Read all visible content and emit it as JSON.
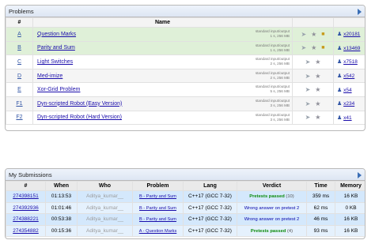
{
  "problems": {
    "header": "Problems",
    "columns": {
      "index": "#",
      "name": "Name"
    },
    "rows": [
      {
        "index": "A",
        "name": "Question Marks",
        "limits_line1": "standard input/output",
        "limits_line2": "1 s, 256 MB",
        "solved": true,
        "solvers": "x20181"
      },
      {
        "index": "B",
        "name": "Parity and Sum",
        "limits_line1": "standard input/output",
        "limits_line2": "1 s, 256 MB",
        "solved": true,
        "solvers": "x13469"
      },
      {
        "index": "C",
        "name": "Light Switches",
        "limits_line1": "standard input/output",
        "limits_line2": "2 s, 256 MB",
        "solved": false,
        "solvers": "x7518"
      },
      {
        "index": "D",
        "name": "Med-imize",
        "limits_line1": "standard input/output",
        "limits_line2": "2 s, 256 MB",
        "solved": false,
        "solvers": "x542"
      },
      {
        "index": "E",
        "name": "Xor-Grid Problem",
        "limits_line1": "standard input/output",
        "limits_line2": "5 s, 256 MB",
        "solved": false,
        "solvers": "x54"
      },
      {
        "index": "F1",
        "name": "Dyn-scripted Robot (Easy Version)",
        "limits_line1": "standard input/output",
        "limits_line2": "3 s, 256 MB",
        "solved": false,
        "solvers": "x234"
      },
      {
        "index": "F2",
        "name": "Dyn-scripted Robot (Hard Version)",
        "limits_line1": "standard input/output",
        "limits_line2": "3 s, 256 MB",
        "solved": false,
        "solvers": "x41"
      }
    ]
  },
  "submissions": {
    "header": "My Submissions",
    "columns": {
      "id": "#",
      "when": "When",
      "who": "Who",
      "problem": "Problem",
      "lang": "Lang",
      "verdict": "Verdict",
      "time": "Time",
      "memory": "Memory"
    },
    "rows": [
      {
        "id": "274398151",
        "when": "01:13:53",
        "who": "Aditya_kumar__",
        "problem": "B - Parity and Sum",
        "lang": "C++17 (GCC 7-32)",
        "verdict": "Pretests passed",
        "verdict_count": "(10)",
        "accepted": true,
        "time": "359 ms",
        "memory": "16 KB"
      },
      {
        "id": "274392936",
        "when": "01:01:46",
        "who": "Aditya_kumar__",
        "problem": "B - Parity and Sum",
        "lang": "C++17 (GCC 7-32)",
        "verdict": "Wrong answer on pretest 2",
        "verdict_count": "",
        "accepted": false,
        "time": "62 ms",
        "memory": "0 KB"
      },
      {
        "id": "274388221",
        "when": "00:53:38",
        "who": "Aditya_kumar__",
        "problem": "B - Parity and Sum",
        "lang": "C++17 (GCC 7-32)",
        "verdict": "Wrong answer on pretest 2",
        "verdict_count": "",
        "accepted": false,
        "time": "46 ms",
        "memory": "16 KB"
      },
      {
        "id": "274354882",
        "when": "00:15:36",
        "who": "Aditya_kumar__",
        "problem": "A - Question Marks",
        "lang": "C++17 (GCC 7-32)",
        "verdict": "Pretests passed",
        "verdict_count": "(4)",
        "accepted": true,
        "time": "93 ms",
        "memory": "16 KB"
      }
    ]
  },
  "icons": {
    "submit": "paper-plane-icon",
    "favorite": "star-icon",
    "lock": "lock-icon",
    "hack": "wand-icon",
    "solvers": "user-icon",
    "expand": "arrow-right-icon"
  },
  "colors": {
    "solved_row": "#dff0d8",
    "submission_row": "#d4e8fc",
    "accepted": "#0a8a0a",
    "wrong_answer": "#0000aa",
    "link": "#1a0dab"
  }
}
